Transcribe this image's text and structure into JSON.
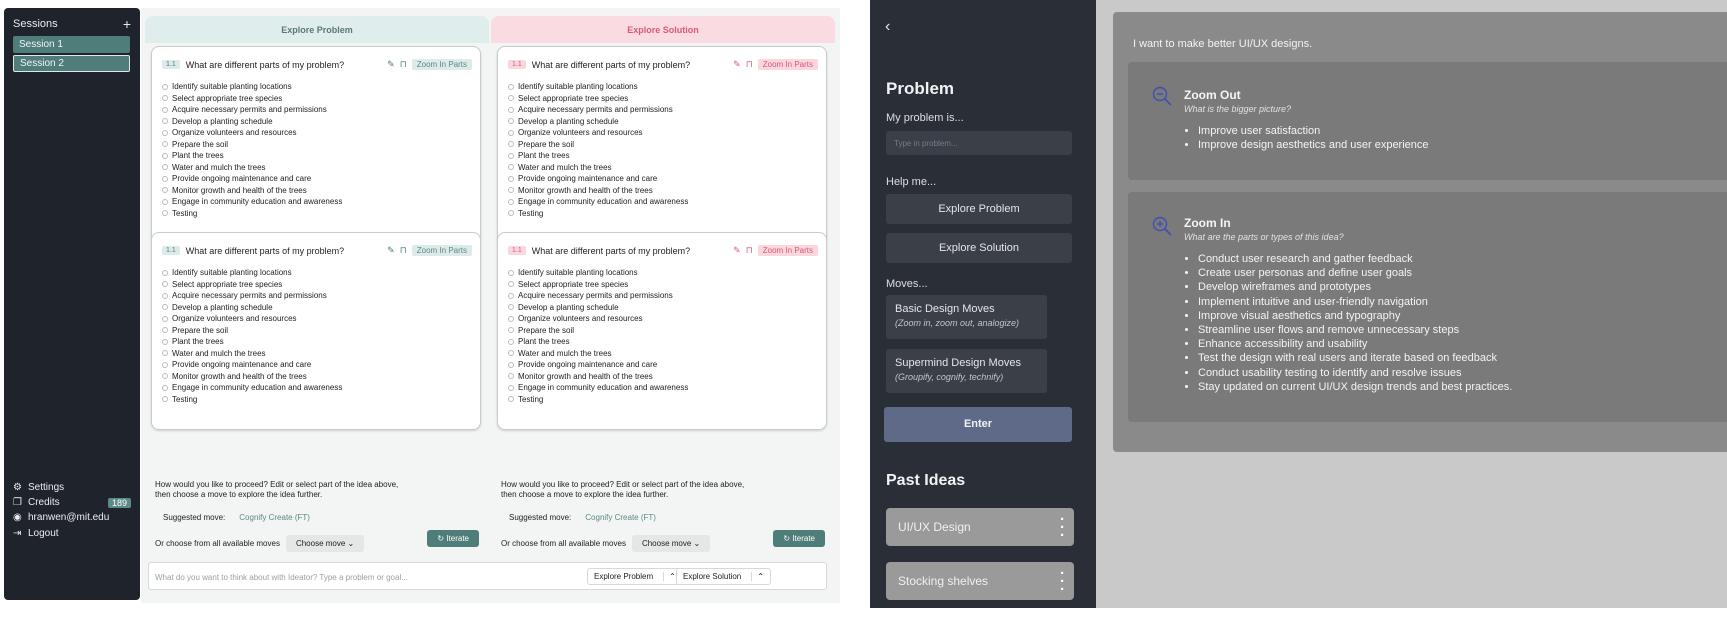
{
  "left": {
    "sidebar": {
      "title": "Sessions",
      "add": "+",
      "sessions": [
        "Session 1",
        "Session 2"
      ],
      "footer": {
        "settings": "Settings",
        "credits": "Credits",
        "credits_count": "189",
        "email": "hranwen@mit.edu",
        "logout": "Logout"
      }
    },
    "columns": [
      {
        "header": "Explore Problem",
        "cards": [
          {
            "num": "1.1",
            "question": "What are different parts of my problem?",
            "tag": "Zoom In Parts"
          },
          {
            "num": "1.1",
            "question": "What are different parts of my problem?",
            "tag": "Zoom In Parts"
          }
        ],
        "proceed": "How would you like to proceed? Edit or select part of the idea above, then choose a move to explore the idea further.",
        "suggested_label": "Suggested move:",
        "suggested_move": "Cognify Create (FT)",
        "choose_label": "Or choose from all available moves",
        "choose_btn": "Choose move",
        "iterate": "Iterate"
      },
      {
        "header": "Explore Solution",
        "cards": [
          {
            "num": "1.1",
            "question": "What are different parts of my problem?",
            "tag": "Zoom In Parts"
          },
          {
            "num": "1.1",
            "question": "What are different parts of my problem?",
            "tag": "Zoom In Parts"
          }
        ],
        "proceed": "How would you like to proceed? Edit or select part of the idea above, then choose a move to explore the idea further.",
        "suggested_label": "Suggested move:",
        "suggested_move": "Cognify Create (FT)",
        "choose_label": "Or choose from all available moves",
        "choose_btn": "Choose move",
        "iterate": "Iterate"
      }
    ],
    "items": [
      "Identify suitable planting locations",
      "Select appropriate tree species",
      "Acquire necessary permits and permissions",
      "Develop a planting schedule",
      "Organize volunteers and resources",
      "Prepare the soil",
      "Plant the trees",
      "Water and mulch the trees",
      "Provide ongoing maintenance and care",
      "Monitor growth and health of the trees",
      "Engage in community education and awareness",
      "Testing"
    ],
    "bottom": {
      "placeholder": "What do you want to think about with Ideator? Type a problem or goal...",
      "explore_problem": "Explore Problem",
      "explore_solution": "Explore Solution"
    }
  },
  "right": {
    "back": "‹",
    "problem_title": "Problem",
    "my_problem_label": "My problem is...",
    "input_placeholder": "Type in problem...",
    "help_label": "Help me...",
    "explore_problem": "Explore Problem",
    "explore_solution": "Explore Solution",
    "moves_label": "Moves...",
    "moves": [
      {
        "title": "Basic Design Moves",
        "sub": "(Zoom in, zoom out, analogize)"
      },
      {
        "title": "Supermind Design Moves",
        "sub": "(Groupify, cognify, technify)"
      }
    ],
    "enter": "Enter",
    "past_title": "Past Ideas",
    "past": [
      "UI/UX Design",
      "Stocking shelves"
    ],
    "prompt": "I want to make better UI/UX designs.",
    "zoom_out": {
      "title": "Zoom Out",
      "sub": "What is the bigger picture?",
      "items": [
        "Improve user satisfaction",
        "Improve design aesthetics and user experience"
      ]
    },
    "zoom_in": {
      "title": "Zoom In",
      "sub": "What are the parts or types of this idea?",
      "items": [
        "Conduct user research and gather feedback",
        "Create user personas and define user goals",
        "Develop wireframes and prototypes",
        "Implement intuitive and user-friendly navigation",
        "Improve visual aesthetics and typography",
        "Streamline user flows and remove unnecessary steps",
        "Enhance accessibility and usability",
        "Test the design with real users and iterate based on feedback",
        "Conduct usability testing to identify and resolve issues",
        "Stay updated on current UI/UX design trends and best practices."
      ]
    }
  }
}
